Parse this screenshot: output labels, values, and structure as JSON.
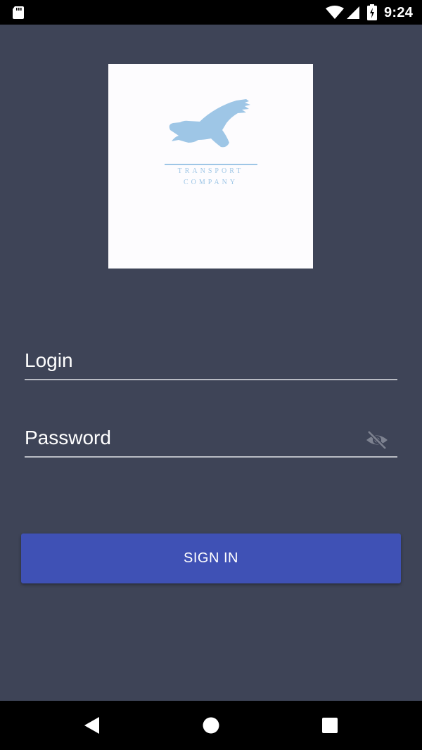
{
  "status_bar": {
    "time": "9:24",
    "icons": [
      "sd-card-icon",
      "wifi-icon",
      "signal-icon",
      "battery-charging-icon"
    ]
  },
  "logo": {
    "line1": "TRANSPORT",
    "line2": "COMPANY",
    "icon": "eagle-icon",
    "color": "#9ec6e6"
  },
  "form": {
    "login_placeholder": "Login",
    "login_value": "",
    "password_placeholder": "Password",
    "password_value": "",
    "password_toggle_icon": "eye-off-icon"
  },
  "actions": {
    "sign_in_label": "SIGN IN",
    "accent_color": "#3f51b5"
  },
  "nav_bar": {
    "icons": [
      "back-icon",
      "home-icon",
      "recents-icon"
    ]
  },
  "theme": {
    "background": "#3e4457"
  }
}
